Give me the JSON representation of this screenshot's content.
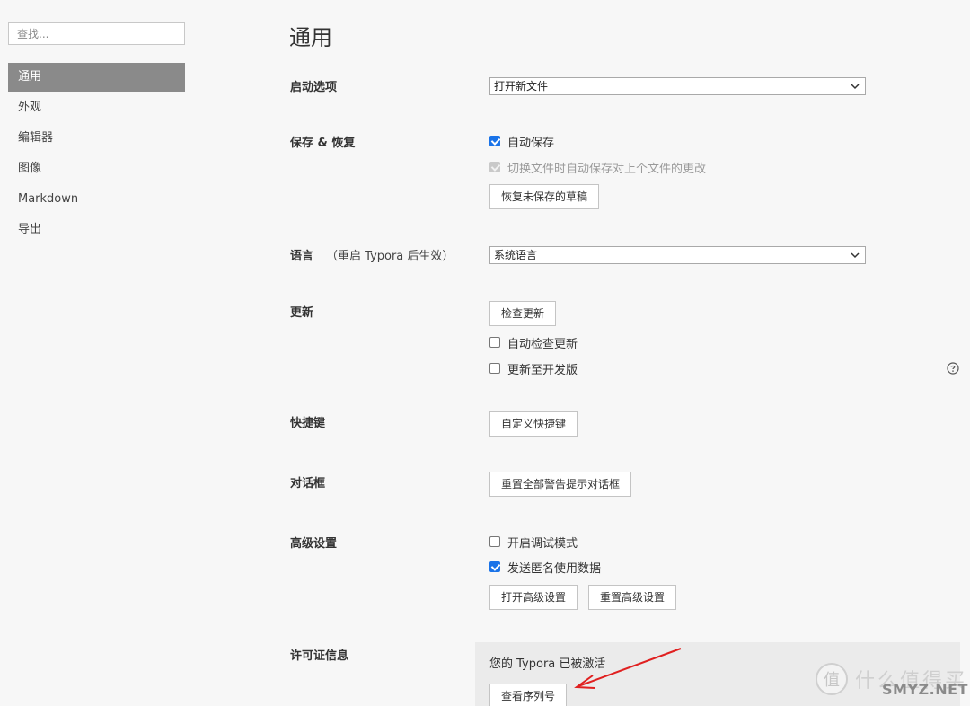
{
  "sidebar": {
    "search_placeholder": "查找...",
    "items": [
      {
        "label": "通用",
        "active": true
      },
      {
        "label": "外观"
      },
      {
        "label": "编辑器"
      },
      {
        "label": "图像"
      },
      {
        "label": "Markdown"
      },
      {
        "label": "导出"
      }
    ]
  },
  "main": {
    "title": "通用",
    "startup": {
      "label": "启动选项",
      "select_value": "打开新文件"
    },
    "save": {
      "label": "保存 & 恢复",
      "autosave": {
        "label": "自动保存",
        "checked": true
      },
      "autosave_on_switch": {
        "label": "切换文件时自动保存对上个文件的更改",
        "checked": true,
        "disabled": true
      },
      "recover_button": "恢复未保存的草稿"
    },
    "language": {
      "label": "语言",
      "note": "（重启 Typora 后生效）",
      "select_value": "系统语言"
    },
    "update": {
      "label": "更新",
      "check_button": "检查更新",
      "auto_check": {
        "label": "自动检查更新",
        "checked": false
      },
      "dev_channel": {
        "label": "更新至开发版",
        "checked": false
      }
    },
    "shortcuts": {
      "label": "快捷键",
      "button": "自定义快捷键"
    },
    "dialog": {
      "label": "对话框",
      "button": "重置全部警告提示对话框"
    },
    "advanced": {
      "label": "高级设置",
      "debug_mode": {
        "label": "开启调试模式",
        "checked": false
      },
      "anon_data": {
        "label": "发送匿名使用数据",
        "checked": true
      },
      "open_button": "打开高级设置",
      "reset_button": "重置高级设置"
    },
    "license": {
      "label": "许可证信息",
      "status": "您的 Typora 已被激活",
      "button": "查看序列号"
    }
  },
  "watermark": {
    "logo": "值",
    "text": "什么值得买",
    "sub": "SMYZ.NET"
  },
  "colors": {
    "active_nav": "#8a8a8a",
    "checkbox": "#1a73e8",
    "arrow": "#e02020"
  }
}
